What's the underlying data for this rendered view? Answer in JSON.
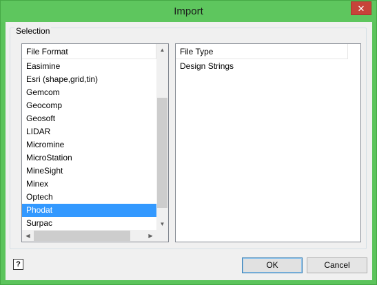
{
  "window": {
    "title": "Import",
    "close_glyph": "✕",
    "accent_color": "#5ec65e"
  },
  "selection": {
    "legend": "Selection"
  },
  "file_format": {
    "header": "File Format",
    "items": [
      "Easimine",
      "Esri (shape,grid,tin)",
      "Gemcom",
      "Geocomp",
      "Geosoft",
      "LIDAR",
      "Micromine",
      "MicroStation",
      "MineSight",
      "Minex",
      "Optech",
      "Phodat",
      "Surpac"
    ],
    "selected": "Phodat"
  },
  "file_type": {
    "header": "File Type",
    "items": [
      "Design Strings"
    ]
  },
  "scrollbars": {
    "up_icon": "▲",
    "down_icon": "▼",
    "left_icon": "◀",
    "right_icon": "▶"
  },
  "footer": {
    "help_icon": "?",
    "ok_label": "OK",
    "cancel_label": "Cancel"
  }
}
